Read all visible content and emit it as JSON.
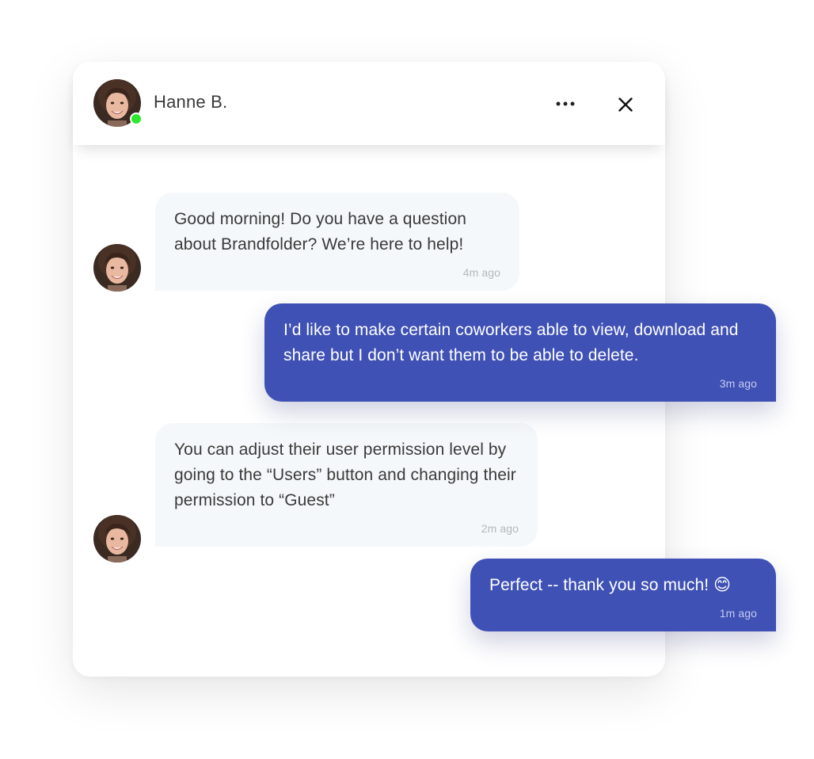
{
  "chat": {
    "contact_name": "Hanne B.",
    "status": "online",
    "status_color": "#2ee82e",
    "accent_color": "#3f51b5",
    "header_icons": [
      "more-horizontal-icon",
      "close-icon"
    ]
  },
  "messages": [
    {
      "direction": "incoming",
      "text": "Good morning! Do you have a question about Brandfolder? We’re here to help!",
      "time": "4m ago"
    },
    {
      "direction": "outgoing",
      "text": "I’d like to make certain coworkers able to view, download and share but I don’t want them to be able to delete.",
      "time": "3m ago"
    },
    {
      "direction": "incoming",
      "text": "You can adjust their user permission level by going to the “Users” button and changing their permission to “Guest”",
      "time": "2m ago"
    },
    {
      "direction": "outgoing",
      "text": "Perfect -- thank you so much! 😊",
      "time": "1m ago"
    }
  ]
}
